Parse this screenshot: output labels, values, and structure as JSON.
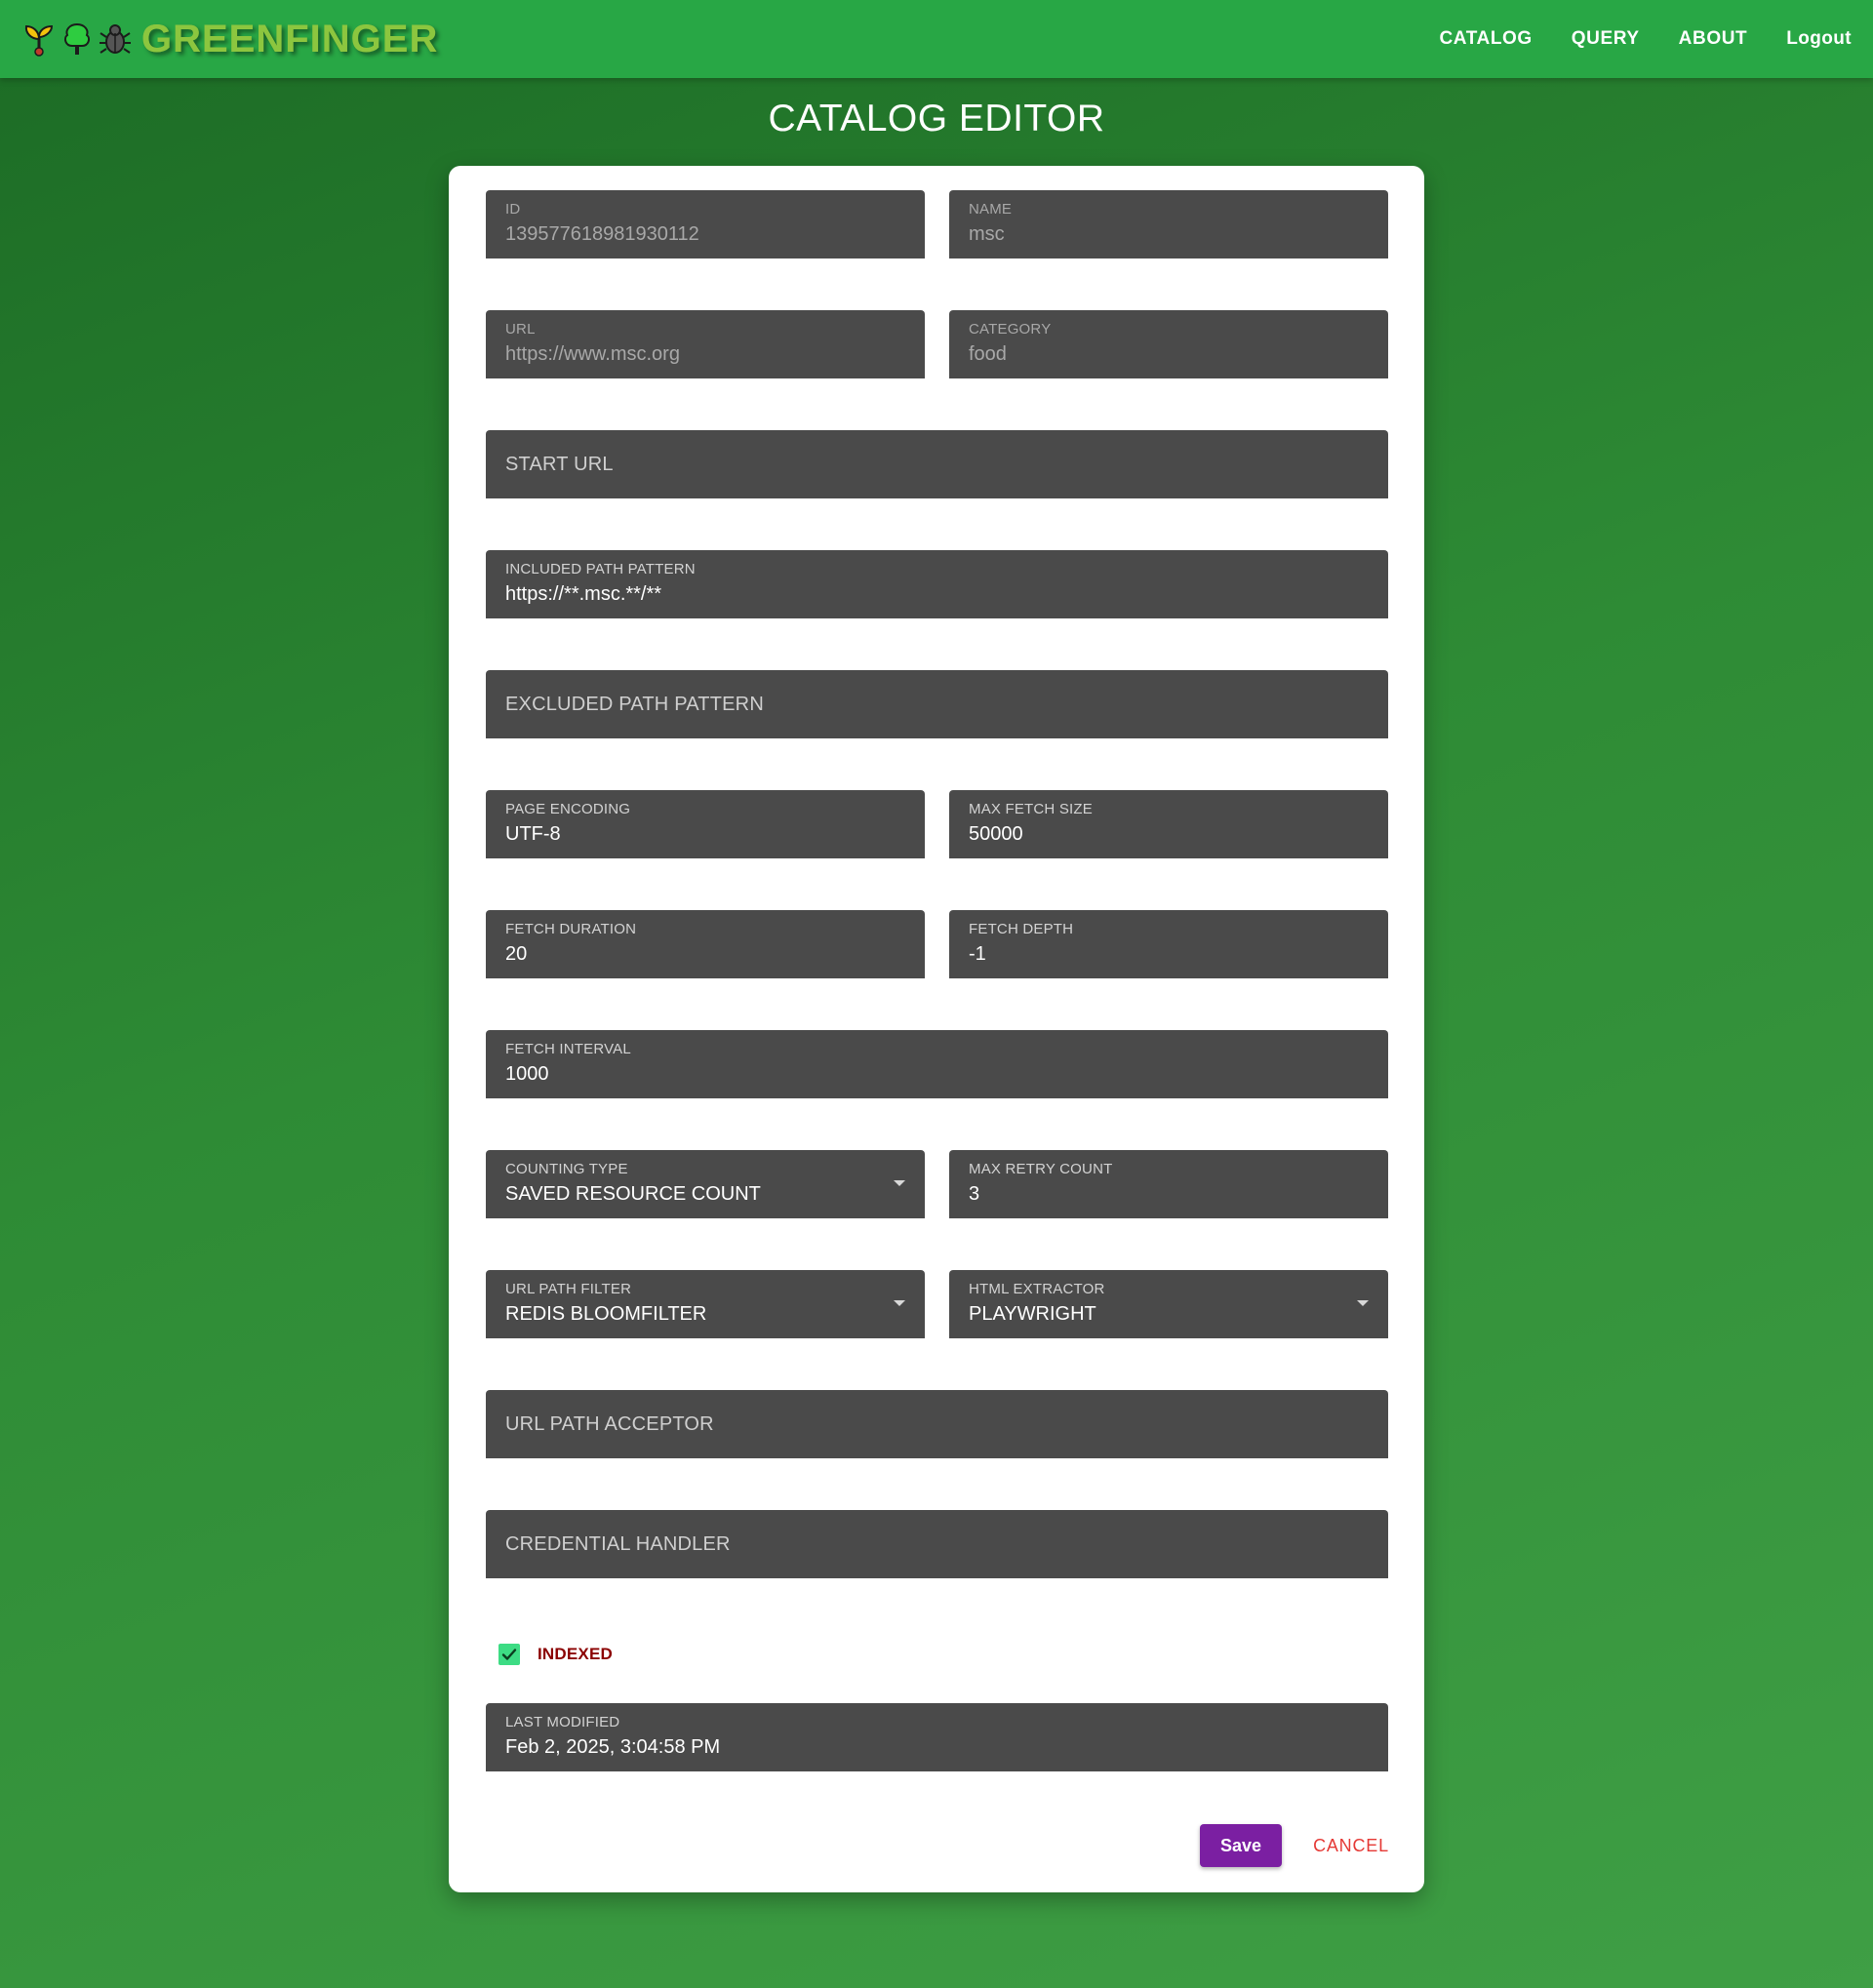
{
  "header": {
    "brand": "GREENFINGER",
    "icons": [
      "sprout-icon",
      "tree-icon",
      "bug-icon"
    ],
    "nav": [
      "CATALOG",
      "QUERY",
      "ABOUT",
      "Logout"
    ]
  },
  "page_title": "CATALOG EDITOR",
  "form": {
    "id": {
      "label": "ID",
      "value": "139577618981930112"
    },
    "name": {
      "label": "NAME",
      "value": "msc"
    },
    "url": {
      "label": "URL",
      "value": "https://www.msc.org"
    },
    "category": {
      "label": "CATEGORY",
      "value": "food"
    },
    "start_url": {
      "label": "START URL",
      "value": ""
    },
    "included_path_pattern": {
      "label": "INCLUDED PATH PATTERN",
      "value": "https://**.msc.**/**"
    },
    "excluded_path_pattern": {
      "label": "EXCLUDED PATH PATTERN",
      "value": ""
    },
    "page_encoding": {
      "label": "PAGE ENCODING",
      "value": "UTF-8"
    },
    "max_fetch_size": {
      "label": "MAX FETCH SIZE",
      "value": "50000"
    },
    "fetch_duration": {
      "label": "FETCH DURATION",
      "value": "20"
    },
    "fetch_depth": {
      "label": "FETCH DEPTH",
      "value": "-1"
    },
    "fetch_interval": {
      "label": "FETCH INTERVAL",
      "value": "1000"
    },
    "counting_type": {
      "label": "COUNTING TYPE",
      "value": "SAVED RESOURCE COUNT"
    },
    "max_retry_count": {
      "label": "MAX RETRY COUNT",
      "value": "3"
    },
    "url_path_filter": {
      "label": "URL PATH FILTER",
      "value": "REDIS BLOOMFILTER"
    },
    "html_extractor": {
      "label": "HTML EXTRACTOR",
      "value": "PLAYWRIGHT"
    },
    "url_path_acceptor": {
      "label": "URL PATH ACCEPTOR",
      "value": ""
    },
    "credential_handler": {
      "label": "CREDENTIAL HANDLER",
      "value": ""
    },
    "indexed": {
      "label": "INDEXED",
      "checked": true
    },
    "last_modified": {
      "label": "LAST MODIFIED",
      "value": "Feb 2, 2025, 3:04:58 PM"
    }
  },
  "actions": {
    "save": "Save",
    "cancel": "CANCEL"
  },
  "colors": {
    "topbar": "#28a745",
    "field_bg": "#4a4a4a",
    "save_button": "#7b1fa2",
    "cancel_text": "#e53935",
    "checkbox": "#3ddc84",
    "indexed_label": "#8b0000"
  }
}
